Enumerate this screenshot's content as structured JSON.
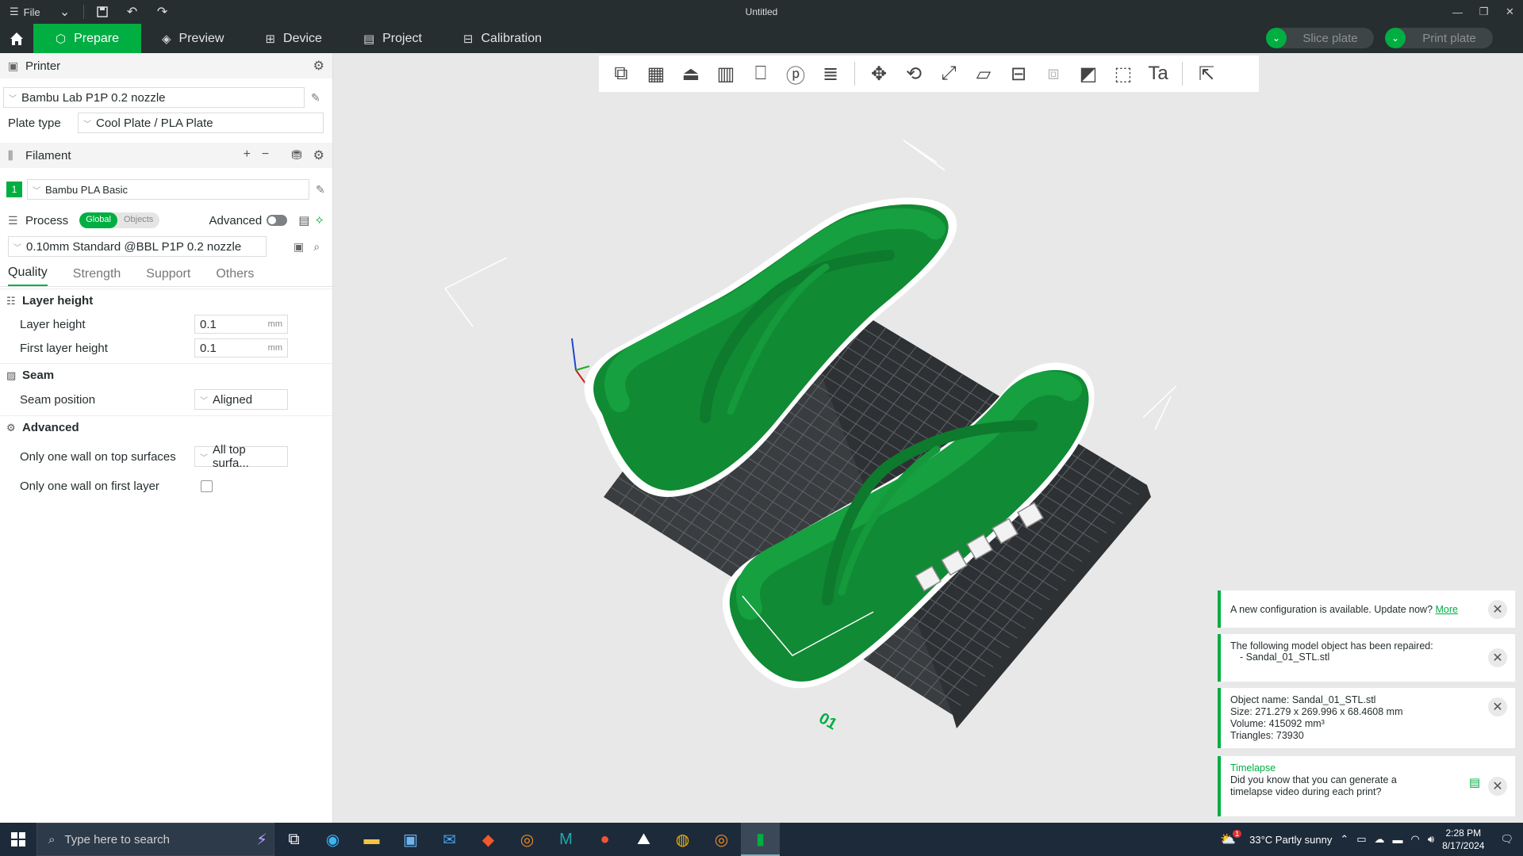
{
  "titlebar": {
    "file_label": "File",
    "title": "Untitled"
  },
  "nav": {
    "tabs": [
      {
        "label": "Prepare",
        "icon": "cube-icon"
      },
      {
        "label": "Preview",
        "icon": "layers-icon"
      },
      {
        "label": "Device",
        "icon": "device-icon"
      },
      {
        "label": "Project",
        "icon": "project-icon"
      },
      {
        "label": "Calibration",
        "icon": "calibration-icon"
      }
    ],
    "slice_label": "Slice plate",
    "print_label": "Print plate"
  },
  "sidebar": {
    "printer": {
      "title": "Printer",
      "selected": "Bambu Lab P1P 0.2 nozzle",
      "plate_type_label": "Plate type",
      "plate_type_value": "Cool Plate / PLA Plate"
    },
    "filament": {
      "title": "Filament",
      "items": [
        {
          "num": "1",
          "name": "Bambu PLA Basic",
          "color": "#00ae42"
        }
      ]
    },
    "process": {
      "title": "Process",
      "global_label": "Global",
      "objects_label": "Objects",
      "advanced_label": "Advanced",
      "preset": "0.10mm Standard @BBL P1P 0.2 nozzle",
      "tabs": [
        "Quality",
        "Strength",
        "Support",
        "Others"
      ]
    },
    "groups": {
      "layer_height": {
        "title": "Layer height",
        "layer_height_label": "Layer height",
        "layer_height_value": "0.1",
        "first_layer_label": "First layer height",
        "first_layer_value": "0.1",
        "unit": "mm"
      },
      "seam": {
        "title": "Seam",
        "position_label": "Seam position",
        "position_value": "Aligned"
      },
      "advanced": {
        "title": "Advanced",
        "top_wall_label": "Only one wall on top surfaces",
        "top_wall_value": "All top surfa...",
        "first_layer_wall_label": "Only one wall on first layer"
      }
    }
  },
  "viewport": {
    "plate_number": "01"
  },
  "notifications": {
    "config": {
      "text": "A new configuration is available. Update now?",
      "link": "More"
    },
    "repaired": {
      "line1": "The following model object has been repaired:",
      "line2": "- Sandal_01_STL.stl"
    },
    "object_info": {
      "name": "Object name: Sandal_01_STL.stl",
      "size": "Size: 271.279 x 269.996 x 68.4608 mm",
      "volume": "Volume: 415092 mm³",
      "triangles": "Triangles: 73930"
    },
    "timelapse": {
      "title": "Timelapse",
      "text": "Did you know that you can generate a timelapse video during each print?"
    }
  },
  "taskbar": {
    "search_placeholder": "Type here to search",
    "weather": "33°C  Partly sunny",
    "weather_badge": "1",
    "time": "2:28 PM",
    "date": "8/17/2024"
  }
}
